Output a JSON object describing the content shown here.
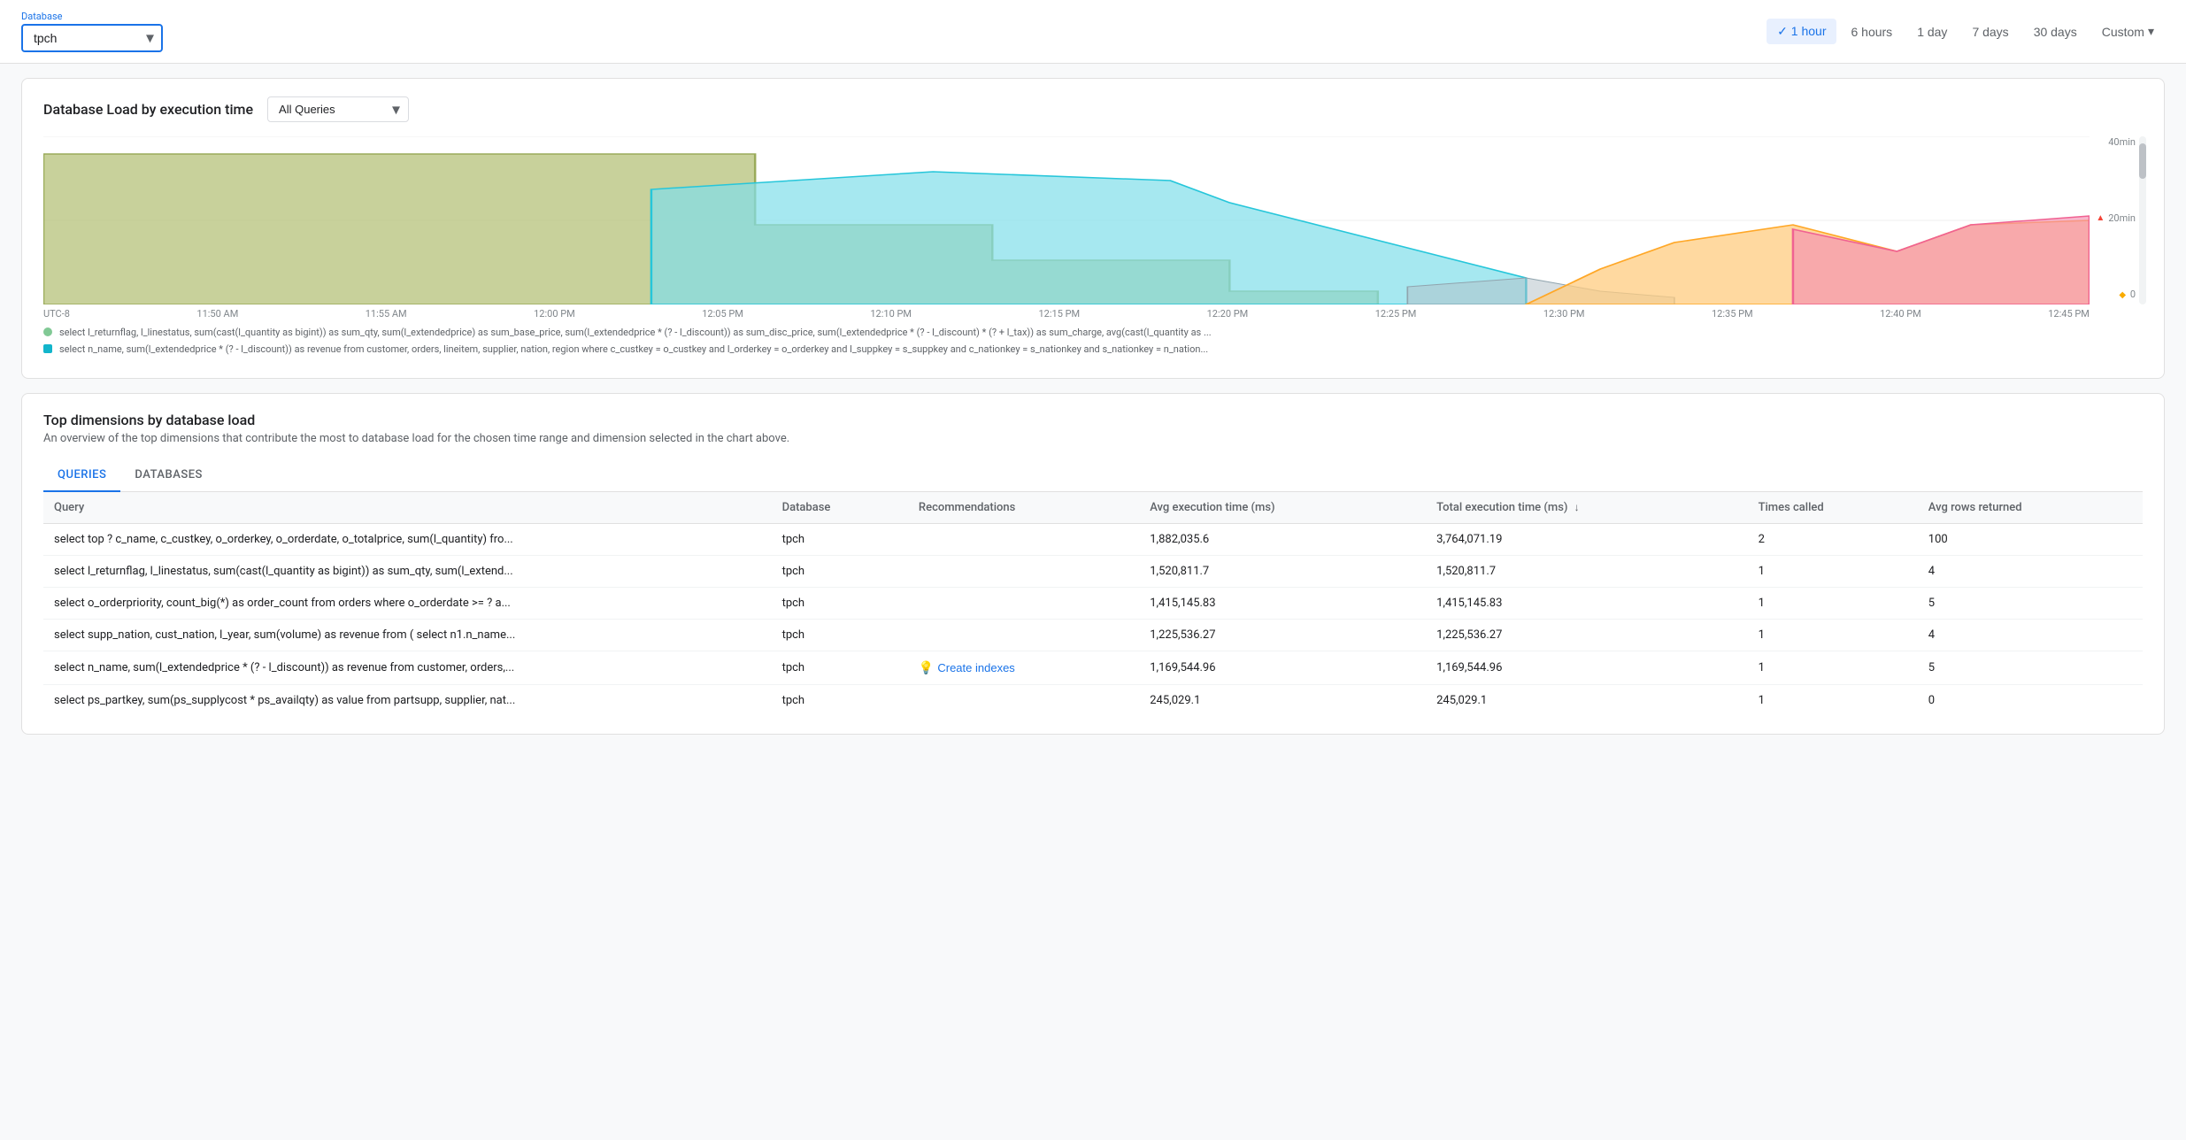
{
  "header": {
    "database_label": "Database",
    "database_value": "tpch",
    "time_options": [
      {
        "id": "1hour",
        "label": "1 hour",
        "active": true,
        "show_check": true
      },
      {
        "id": "6hours",
        "label": "6 hours",
        "active": false,
        "show_check": false
      },
      {
        "id": "1day",
        "label": "1 day",
        "active": false,
        "show_check": false
      },
      {
        "id": "7days",
        "label": "7 days",
        "active": false,
        "show_check": false
      },
      {
        "id": "30days",
        "label": "30 days",
        "active": false,
        "show_check": false
      },
      {
        "id": "custom",
        "label": "Custom",
        "active": false,
        "show_check": false,
        "has_dropdown": true
      }
    ]
  },
  "chart_section": {
    "title": "Database Load by execution time",
    "query_filter": "All Queries",
    "y_labels": [
      "40min",
      "20min",
      "0"
    ],
    "x_labels": [
      "UTC-8",
      "11:50 AM",
      "11:55 AM",
      "12:00 PM",
      "12:05 PM",
      "12:10 PM",
      "12:15 PM",
      "12:20 PM",
      "12:25 PM",
      "12:30 PM",
      "12:35 PM",
      "12:40 PM",
      "12:45 PM"
    ],
    "legend": [
      {
        "color": "#81c995",
        "shape": "circle",
        "text": "select l_returnflag, l_linestatus, sum(cast(l_quantity as bigint)) as sum_qty, sum(l_extendedprice) as sum_base_price, sum(l_extendedprice * (? - l_discount)) as sum_disc_price, sum(l_extendedprice * (? - l_discount) * (? + l_tax)) as sum_charge, avg(cast(l_quantity as ..."
      },
      {
        "color": "#12b5cb",
        "shape": "square",
        "text": "select n_name, sum(l_extendedprice * (? - l_discount)) as revenue from customer, orders, lineitem, supplier, nation, region where c_custkey = o_custkey and l_orderkey = o_orderkey and l_suppkey = s_suppkey and c_nationkey = s_nationkey and s_nationkey = n_nation..."
      }
    ]
  },
  "bottom_section": {
    "title": "Top dimensions by database load",
    "description": "An overview of the top dimensions that contribute the most to database load for the chosen time range and dimension selected in the chart above.",
    "tabs": [
      {
        "id": "queries",
        "label": "QUERIES",
        "active": true
      },
      {
        "id": "databases",
        "label": "DATABASES",
        "active": false
      }
    ],
    "table": {
      "columns": [
        {
          "id": "query",
          "label": "Query",
          "sortable": false
        },
        {
          "id": "database",
          "label": "Database",
          "sortable": false
        },
        {
          "id": "recommendations",
          "label": "Recommendations",
          "sortable": false
        },
        {
          "id": "avg_exec",
          "label": "Avg execution time (ms)",
          "sortable": false
        },
        {
          "id": "total_exec",
          "label": "Total execution time (ms)",
          "sortable": true
        },
        {
          "id": "times_called",
          "label": "Times called",
          "sortable": false
        },
        {
          "id": "avg_rows",
          "label": "Avg rows returned",
          "sortable": false
        }
      ],
      "rows": [
        {
          "query": "select top ? c_name, c_custkey, o_orderkey, o_orderdate, o_totalprice, sum(l_quantity) fro...",
          "database": "tpch",
          "recommendations": "",
          "avg_exec": "1,882,035.6",
          "total_exec": "3,764,071.19",
          "times_called": "2",
          "avg_rows": "100"
        },
        {
          "query": "select l_returnflag, l_linestatus, sum(cast(l_quantity as bigint)) as sum_qty, sum(l_extend...",
          "database": "tpch",
          "recommendations": "",
          "avg_exec": "1,520,811.7",
          "total_exec": "1,520,811.7",
          "times_called": "1",
          "avg_rows": "4"
        },
        {
          "query": "select o_orderpriority, count_big(*) as order_count from orders where o_orderdate >= ? a...",
          "database": "tpch",
          "recommendations": "",
          "avg_exec": "1,415,145.83",
          "total_exec": "1,415,145.83",
          "times_called": "1",
          "avg_rows": "5"
        },
        {
          "query": "select supp_nation, cust_nation, l_year, sum(volume) as revenue from ( select n1.n_name...",
          "database": "tpch",
          "recommendations": "",
          "avg_exec": "1,225,536.27",
          "total_exec": "1,225,536.27",
          "times_called": "1",
          "avg_rows": "4"
        },
        {
          "query": "select n_name, sum(l_extendedprice * (? - l_discount)) as revenue from customer, orders,...",
          "database": "tpch",
          "recommendations": "create_indexes",
          "avg_exec": "1,169,544.96",
          "total_exec": "1,169,544.96",
          "times_called": "1",
          "avg_rows": "5"
        },
        {
          "query": "select ps_partkey, sum(ps_supplycost * ps_availqty) as value from partsupp, supplier, nat...",
          "database": "tpch",
          "recommendations": "",
          "avg_exec": "245,029.1",
          "total_exec": "245,029.1",
          "times_called": "1",
          "avg_rows": "0"
        }
      ]
    }
  },
  "icons": {
    "check": "✓",
    "dropdown_arrow": "▾",
    "sort_down": "↓",
    "bulb": "💡",
    "triangle_up": "▲",
    "diamond": "◆"
  }
}
